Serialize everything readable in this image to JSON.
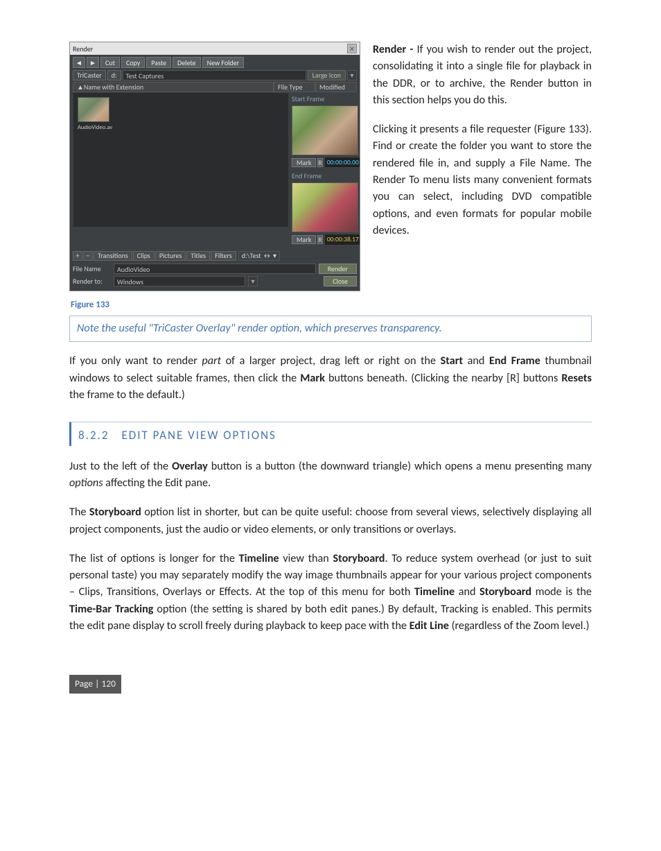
{
  "render_window": {
    "title": "Render",
    "toolbar": {
      "back_icon": "◄",
      "fwd_icon": "►",
      "cut": "Cut",
      "copy": "Copy",
      "paste": "Paste",
      "delete": "Delete",
      "new_folder": "New Folder"
    },
    "path": {
      "seg1": "TriCaster",
      "seg2": "d:",
      "seg3": "Test Captures"
    },
    "view_mode": "Large Icon",
    "columns": {
      "name": "Name with Extension",
      "type": "File Type",
      "modified": "Modified"
    },
    "thumbnail_label": "AudioVideo.av",
    "preview": {
      "start_label": "Start Frame",
      "end_label": "End Frame",
      "mark": "Mark",
      "reset": "R",
      "start_tc": "00:00:00.00",
      "end_tc": "00:00:38.17"
    },
    "tabs": {
      "plus": "+",
      "minus": "−",
      "transitions": "Transitions",
      "clips": "Clips",
      "pictures": "Pictures",
      "titles": "Titles",
      "filters": "Filters",
      "path": "d:\\Test ↔ ▾"
    },
    "file_name_label": "File Name",
    "file_name_value": "AudioVideo",
    "render_to_label": "Render to:",
    "render_to_value": "Windows",
    "render_btn": "Render",
    "close_btn": "Close"
  },
  "intro": {
    "p1_prefix": "Render - ",
    "p1_rest": "If you wish to render out the project, consolidating it into a single file for playback in the DDR, or to archive, the Render button in this section helps you do this.",
    "p2": "Clicking it presents a file requester (Figure 133).  Find or create the folder you want to store the rendered file in, and supply a File Name.  The Render To menu lists many convenient formats you can select, including DVD compatible options, and even formats for popular mobile devices."
  },
  "figure_caption": "Figure 133",
  "note": "Note the useful \"TriCaster Overlay\" render option, which preserves transparency.",
  "para_partial": {
    "a": "If you only want to render ",
    "part": "part",
    "b": " of a larger project, drag left or right on the ",
    "start": "Start",
    "c": " and ",
    "end": "End Frame",
    "d": " thumbnail windows to select suitable frames, then click the ",
    "mark": "Mark",
    "e": " buttons beneath.  (Clicking the nearby [R] buttons ",
    "resets": "Resets",
    "f": " the frame to the default.)"
  },
  "section": {
    "num": "8.2.2",
    "title": "EDIT PANE VIEW OPTIONS"
  },
  "p_overlay": {
    "a": "Just to the left of the ",
    "overlay": "Overlay",
    "b": " button is a button (the downward triangle) which opens a menu presenting many ",
    "options": "options",
    "c": " affecting the Edit pane."
  },
  "p_storyboard": {
    "a": "The ",
    "sb": "Storyboard",
    "b": " option list in shorter, but can be quite useful: choose from several views, selectively displaying all project components, just the audio or video elements, or only transitions or overlays."
  },
  "p_timeline": {
    "a": "The list of options is longer for the ",
    "tl": "Timeline",
    "b": " view than ",
    "sb": "Storyboard",
    "c": ".  To reduce system overhead (or just to suit personal taste) you may separately modify the way image thumbnails appear for your various project components – Clips, Transitions, Overlays or Effects.  At the top of this menu for both ",
    "tl2": "Timeline",
    "d": " and ",
    "sb2": "Storyboard",
    "e": " mode is the ",
    "tbt": "Time-Bar Tracking",
    "f": " option (the setting is shared by both edit panes.)  By default, Tracking is enabled.  This permits the edit pane display to scroll freely during playback to keep pace with the ",
    "el": "Edit Line",
    "g": " (regardless of the Zoom level.)"
  },
  "footer": "Page | 120"
}
